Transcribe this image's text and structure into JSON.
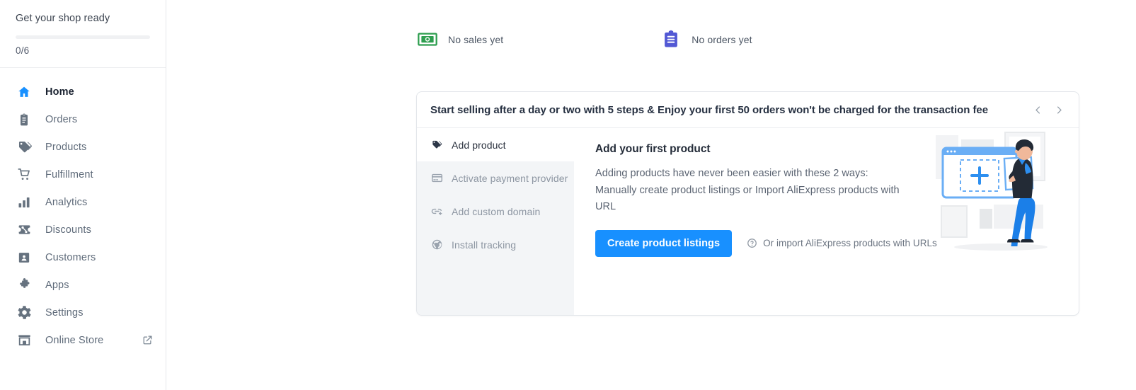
{
  "sidebar": {
    "shop_ready": {
      "title": "Get your shop ready",
      "progress_count": "0/6",
      "progress_percent": 0
    },
    "items": [
      {
        "label": "Home",
        "icon": "home-icon",
        "active": true,
        "external": false
      },
      {
        "label": "Orders",
        "icon": "clipboard-icon",
        "active": false,
        "external": false
      },
      {
        "label": "Products",
        "icon": "tag-icon",
        "active": false,
        "external": false
      },
      {
        "label": "Fulfillment",
        "icon": "cart-icon",
        "active": false,
        "external": false
      },
      {
        "label": "Analytics",
        "icon": "bar-chart-icon",
        "active": false,
        "external": false
      },
      {
        "label": "Discounts",
        "icon": "percent-tag-icon",
        "active": false,
        "external": false
      },
      {
        "label": "Customers",
        "icon": "customers-icon",
        "active": false,
        "external": false
      },
      {
        "label": "Apps",
        "icon": "puzzle-icon",
        "active": false,
        "external": false
      },
      {
        "label": "Settings",
        "icon": "gear-icon",
        "active": false,
        "external": false
      },
      {
        "label": "Online Store",
        "icon": "storefront-icon",
        "active": false,
        "external": true
      }
    ],
    "external_icon": "external-link-icon"
  },
  "stats": [
    {
      "label": "No sales yet",
      "icon": "money-icon",
      "color": "#2e9e4f"
    },
    {
      "label": "No orders yet",
      "icon": "orders-clipboard-icon",
      "color": "#5258d4"
    }
  ],
  "card": {
    "title": "Start selling after a day or two with 5 steps & Enjoy your first 50 orders won't be charged for the transaction fee",
    "prev_icon": "chevron-left-icon",
    "next_icon": "chevron-right-icon",
    "steps": [
      {
        "label": "Add product",
        "icon": "tag-add-icon",
        "active": true
      },
      {
        "label": "Activate payment provider",
        "icon": "credit-card-icon",
        "active": false
      },
      {
        "label": "Add custom domain",
        "icon": "link-add-icon",
        "active": false
      },
      {
        "label": "Install tracking",
        "icon": "globe-icon",
        "active": false
      }
    ],
    "pane": {
      "title": "Add your first product",
      "description": "Adding products have never been easier with these 2 ways: Manually create product listings or Import AliExpress products with URL",
      "primary_button": "Create product listings",
      "import_link": "Or import AliExpress products with URLs",
      "import_icon": "help-circle-icon",
      "illustration": "person-adding-product-illustration"
    }
  },
  "colors": {
    "accent": "#1890ff",
    "sidebar_border": "#e6e8ea",
    "panel_bg": "#f3f5f7",
    "text_primary": "#212b36",
    "text_muted": "#8d96a2"
  }
}
